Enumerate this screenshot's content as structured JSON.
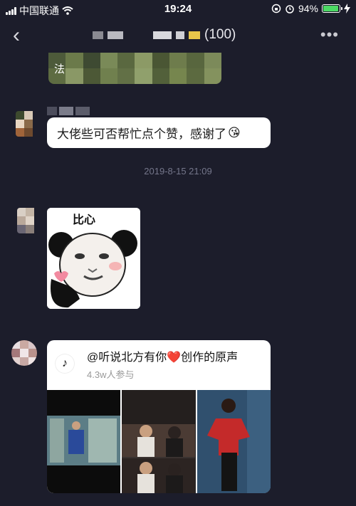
{
  "status": {
    "carrier": "中国联通",
    "time": "19:24",
    "battery": "94%",
    "battery_level": 0.94
  },
  "nav": {
    "back": "‹",
    "member_count": "(100)",
    "more": "•••"
  },
  "messages": {
    "prev_fragment": "法",
    "text_message": "大佬些可否帮忙点个赞，感谢了",
    "emoji": "😘",
    "timestamp": "2019-8-15 21:09",
    "sticker_caption": "比心",
    "card": {
      "title": "@听说北方有你❤️创作的原声",
      "subtitle": "4.3w人参与",
      "app_icon": "tiktok-icon"
    }
  },
  "colors": {
    "background": "#1c1d2b",
    "bubble": "#ffffff",
    "timestamp": "#74768a",
    "battery_fill": "#4cd964"
  }
}
